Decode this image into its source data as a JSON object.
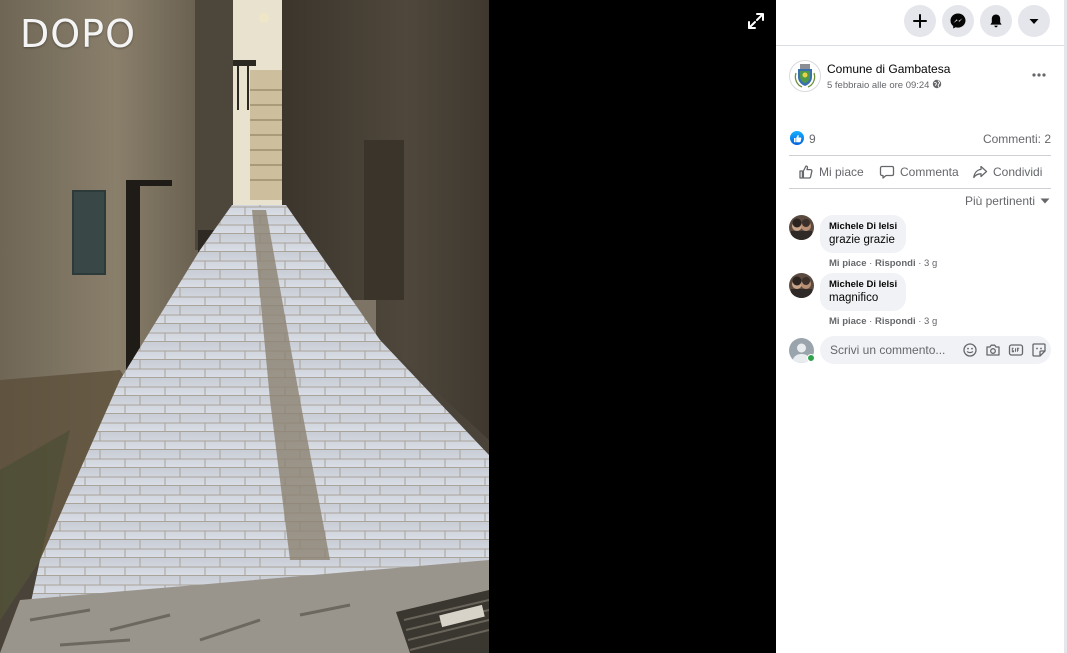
{
  "viewer": {
    "caption": "DOPO",
    "expand_icon": "expand-icon"
  },
  "topbar": {
    "buttons": [
      {
        "name": "create-button",
        "icon": "plus-icon"
      },
      {
        "name": "messenger-button",
        "icon": "messenger-icon"
      },
      {
        "name": "notifications-button",
        "icon": "bell-icon"
      },
      {
        "name": "account-menu-button",
        "icon": "caret-down-icon"
      }
    ]
  },
  "post": {
    "page_name": "Comune di Gambatesa",
    "date": "5 febbraio alle ore 09:24",
    "privacy_icon": "globe-icon"
  },
  "stats": {
    "likes": "9",
    "comments": "Commenti: 2"
  },
  "actions": {
    "like": "Mi piace",
    "comment": "Commenta",
    "share": "Condividi"
  },
  "sort": {
    "label": "Più pertinenti"
  },
  "comments": [
    {
      "author": "Michele Di Ielsi",
      "text": "grazie grazie",
      "like": "Mi piace",
      "reply": "Rispondi",
      "age": "3 g"
    },
    {
      "author": "Michele Di Ielsi",
      "text": "magnifico",
      "like": "Mi piace",
      "reply": "Rispondi",
      "age": "3 g"
    }
  ],
  "composer": {
    "placeholder": "Scrivi un commento...",
    "icons": [
      "emoji-icon",
      "camera-icon",
      "gif-icon",
      "sticker-icon"
    ]
  },
  "colors": {
    "accent": "#1877f2",
    "secondary_text": "#65676b",
    "bubble": "#f0f2f5",
    "online": "#31a24c"
  }
}
